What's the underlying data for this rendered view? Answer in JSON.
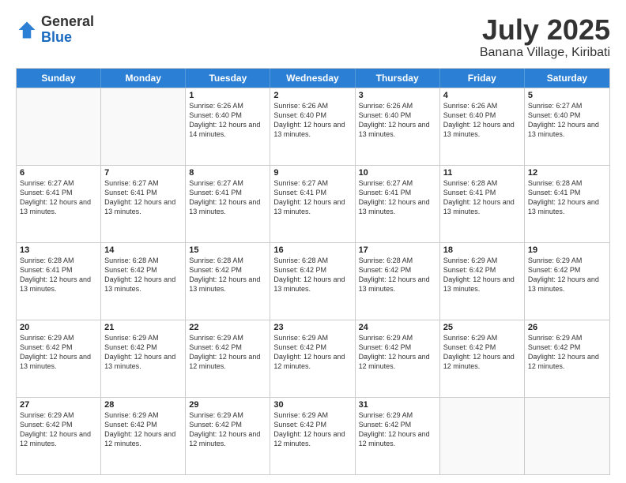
{
  "logo": {
    "general": "General",
    "blue": "Blue"
  },
  "title": "July 2025",
  "subtitle": "Banana Village, Kiribati",
  "calendar": {
    "headers": [
      "Sunday",
      "Monday",
      "Tuesday",
      "Wednesday",
      "Thursday",
      "Friday",
      "Saturday"
    ],
    "rows": [
      [
        {
          "day": "",
          "empty": true
        },
        {
          "day": "",
          "empty": true
        },
        {
          "day": "1",
          "sunrise": "6:26 AM",
          "sunset": "6:40 PM",
          "daylight": "12 hours and 14 minutes."
        },
        {
          "day": "2",
          "sunrise": "6:26 AM",
          "sunset": "6:40 PM",
          "daylight": "12 hours and 13 minutes."
        },
        {
          "day": "3",
          "sunrise": "6:26 AM",
          "sunset": "6:40 PM",
          "daylight": "12 hours and 13 minutes."
        },
        {
          "day": "4",
          "sunrise": "6:26 AM",
          "sunset": "6:40 PM",
          "daylight": "12 hours and 13 minutes."
        },
        {
          "day": "5",
          "sunrise": "6:27 AM",
          "sunset": "6:40 PM",
          "daylight": "12 hours and 13 minutes."
        }
      ],
      [
        {
          "day": "6",
          "sunrise": "6:27 AM",
          "sunset": "6:41 PM",
          "daylight": "12 hours and 13 minutes."
        },
        {
          "day": "7",
          "sunrise": "6:27 AM",
          "sunset": "6:41 PM",
          "daylight": "12 hours and 13 minutes."
        },
        {
          "day": "8",
          "sunrise": "6:27 AM",
          "sunset": "6:41 PM",
          "daylight": "12 hours and 13 minutes."
        },
        {
          "day": "9",
          "sunrise": "6:27 AM",
          "sunset": "6:41 PM",
          "daylight": "12 hours and 13 minutes."
        },
        {
          "day": "10",
          "sunrise": "6:27 AM",
          "sunset": "6:41 PM",
          "daylight": "12 hours and 13 minutes."
        },
        {
          "day": "11",
          "sunrise": "6:28 AM",
          "sunset": "6:41 PM",
          "daylight": "12 hours and 13 minutes."
        },
        {
          "day": "12",
          "sunrise": "6:28 AM",
          "sunset": "6:41 PM",
          "daylight": "12 hours and 13 minutes."
        }
      ],
      [
        {
          "day": "13",
          "sunrise": "6:28 AM",
          "sunset": "6:41 PM",
          "daylight": "12 hours and 13 minutes."
        },
        {
          "day": "14",
          "sunrise": "6:28 AM",
          "sunset": "6:42 PM",
          "daylight": "12 hours and 13 minutes."
        },
        {
          "day": "15",
          "sunrise": "6:28 AM",
          "sunset": "6:42 PM",
          "daylight": "12 hours and 13 minutes."
        },
        {
          "day": "16",
          "sunrise": "6:28 AM",
          "sunset": "6:42 PM",
          "daylight": "12 hours and 13 minutes."
        },
        {
          "day": "17",
          "sunrise": "6:28 AM",
          "sunset": "6:42 PM",
          "daylight": "12 hours and 13 minutes."
        },
        {
          "day": "18",
          "sunrise": "6:29 AM",
          "sunset": "6:42 PM",
          "daylight": "12 hours and 13 minutes."
        },
        {
          "day": "19",
          "sunrise": "6:29 AM",
          "sunset": "6:42 PM",
          "daylight": "12 hours and 13 minutes."
        }
      ],
      [
        {
          "day": "20",
          "sunrise": "6:29 AM",
          "sunset": "6:42 PM",
          "daylight": "12 hours and 13 minutes."
        },
        {
          "day": "21",
          "sunrise": "6:29 AM",
          "sunset": "6:42 PM",
          "daylight": "12 hours and 13 minutes."
        },
        {
          "day": "22",
          "sunrise": "6:29 AM",
          "sunset": "6:42 PM",
          "daylight": "12 hours and 12 minutes."
        },
        {
          "day": "23",
          "sunrise": "6:29 AM",
          "sunset": "6:42 PM",
          "daylight": "12 hours and 12 minutes."
        },
        {
          "day": "24",
          "sunrise": "6:29 AM",
          "sunset": "6:42 PM",
          "daylight": "12 hours and 12 minutes."
        },
        {
          "day": "25",
          "sunrise": "6:29 AM",
          "sunset": "6:42 PM",
          "daylight": "12 hours and 12 minutes."
        },
        {
          "day": "26",
          "sunrise": "6:29 AM",
          "sunset": "6:42 PM",
          "daylight": "12 hours and 12 minutes."
        }
      ],
      [
        {
          "day": "27",
          "sunrise": "6:29 AM",
          "sunset": "6:42 PM",
          "daylight": "12 hours and 12 minutes."
        },
        {
          "day": "28",
          "sunrise": "6:29 AM",
          "sunset": "6:42 PM",
          "daylight": "12 hours and 12 minutes."
        },
        {
          "day": "29",
          "sunrise": "6:29 AM",
          "sunset": "6:42 PM",
          "daylight": "12 hours and 12 minutes."
        },
        {
          "day": "30",
          "sunrise": "6:29 AM",
          "sunset": "6:42 PM",
          "daylight": "12 hours and 12 minutes."
        },
        {
          "day": "31",
          "sunrise": "6:29 AM",
          "sunset": "6:42 PM",
          "daylight": "12 hours and 12 minutes."
        },
        {
          "day": "",
          "empty": true
        },
        {
          "day": "",
          "empty": true
        }
      ]
    ]
  },
  "labels": {
    "sunrise_prefix": "Sunrise: ",
    "sunset_prefix": "Sunset: ",
    "daylight_prefix": "Daylight: "
  }
}
